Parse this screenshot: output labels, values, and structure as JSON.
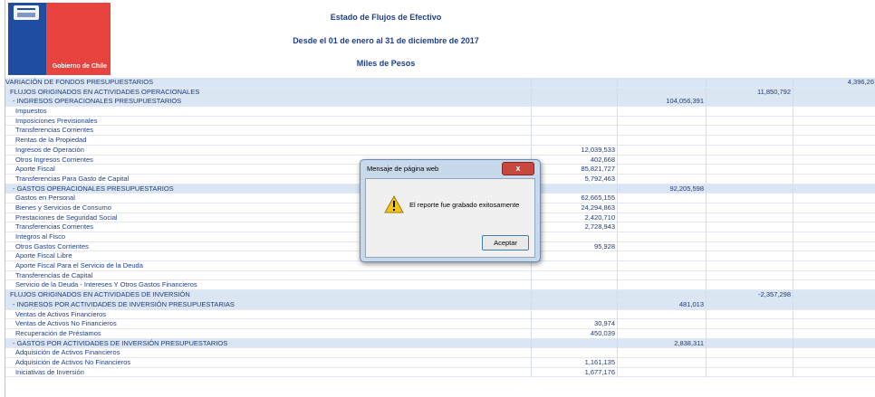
{
  "header": {
    "logo_text": "Gobierno de Chile",
    "title": "Estado de Flujos de Efectivo",
    "subtitle": "Desde el 01 de enero al 31 de diciembre de 2017",
    "units": "Miles de Pesos"
  },
  "rows": [
    {
      "label": "VARIACIÓN DE FONDOS PRESUPUESTARIOS",
      "level": 1,
      "section": true,
      "c1": "",
      "c2": "",
      "c3": "",
      "c4": "4,396,26"
    },
    {
      "label": "FLUJOS ORIGINADOS EN ACTIVIDADES OPERACIONALES",
      "level": 2,
      "section": true,
      "c1": "",
      "c2": "",
      "c3": "11,850,792",
      "c4": ""
    },
    {
      "label": "- INGRESOS OPERACIONALES PRESUPUESTARIOS",
      "level": 3,
      "section": true,
      "c1": "",
      "c2": "104,056,391",
      "c3": "",
      "c4": ""
    },
    {
      "label": "Impuestos",
      "level": 4,
      "section": false,
      "c1": "",
      "c2": "",
      "c3": "",
      "c4": ""
    },
    {
      "label": "Imposiciones Previsionales",
      "level": 4,
      "section": false,
      "c1": "",
      "c2": "",
      "c3": "",
      "c4": ""
    },
    {
      "label": "Transferencias Corrientes",
      "level": 4,
      "section": false,
      "c1": "",
      "c2": "",
      "c3": "",
      "c4": ""
    },
    {
      "label": "Rentas de la Propiedad",
      "level": 4,
      "section": false,
      "c1": "",
      "c2": "",
      "c3": "",
      "c4": ""
    },
    {
      "label": "Ingresos de Operación",
      "level": 4,
      "section": false,
      "c1": "12,039,533",
      "c2": "",
      "c3": "",
      "c4": ""
    },
    {
      "label": "Otros Ingresos Corrientes",
      "level": 4,
      "section": false,
      "c1": "402,668",
      "c2": "",
      "c3": "",
      "c4": ""
    },
    {
      "label": "Aporte Fiscal",
      "level": 4,
      "section": false,
      "c1": "85,821,727",
      "c2": "",
      "c3": "",
      "c4": ""
    },
    {
      "label": "Transferencias Para Gasto de Capital",
      "level": 4,
      "section": false,
      "c1": "5,792,463",
      "c2": "",
      "c3": "",
      "c4": ""
    },
    {
      "label": "- GASTOS OPERACIONALES PRESUPUESTARIOS",
      "level": 3,
      "section": true,
      "c1": "",
      "c2": "92,205,598",
      "c3": "",
      "c4": ""
    },
    {
      "label": "Gastos en Personal",
      "level": 4,
      "section": false,
      "c1": "62,665,155",
      "c2": "",
      "c3": "",
      "c4": ""
    },
    {
      "label": "Bienes y Servicios de Consumo",
      "level": 4,
      "section": false,
      "c1": "24,294,863",
      "c2": "",
      "c3": "",
      "c4": ""
    },
    {
      "label": "Prestaciones de Seguridad Social",
      "level": 4,
      "section": false,
      "c1": "2,420,710",
      "c2": "",
      "c3": "",
      "c4": ""
    },
    {
      "label": "Transferencias Corrientes",
      "level": 4,
      "section": false,
      "c1": "2,728,943",
      "c2": "",
      "c3": "",
      "c4": ""
    },
    {
      "label": "Integros al Fisco",
      "level": 4,
      "section": false,
      "c1": "",
      "c2": "",
      "c3": "",
      "c4": ""
    },
    {
      "label": "Otros Gastos Corrientes",
      "level": 4,
      "section": false,
      "c1": "95,928",
      "c2": "",
      "c3": "",
      "c4": ""
    },
    {
      "label": "Aporte Fiscal Libre",
      "level": 4,
      "section": false,
      "c1": "",
      "c2": "",
      "c3": "",
      "c4": ""
    },
    {
      "label": "Aporte Fiscal Para el Servicio de la Deuda",
      "level": 4,
      "section": false,
      "c1": "",
      "c2": "",
      "c3": "",
      "c4": ""
    },
    {
      "label": "Transferencias de Capital",
      "level": 4,
      "section": false,
      "c1": "",
      "c2": "",
      "c3": "",
      "c4": ""
    },
    {
      "label": "Servicio de la Deuda - Intereses Y Otros Gastos Financieros",
      "level": 4,
      "section": false,
      "c1": "",
      "c2": "",
      "c3": "",
      "c4": ""
    },
    {
      "label": "FLUJOS ORIGINADOS EN ACTIVIDADES DE INVERSIÓN",
      "level": 2,
      "section": true,
      "c1": "",
      "c2": "",
      "c3": "-2,357,298",
      "c4": ""
    },
    {
      "label": "- INGRESOS POR ACTIVIDADES DE INVERSIÓN PRESUPUESTARIAS",
      "level": 3,
      "section": true,
      "c1": "",
      "c2": "481,013",
      "c3": "",
      "c4": ""
    },
    {
      "label": "Ventas de Activos Financieros",
      "level": 4,
      "section": false,
      "c1": "",
      "c2": "",
      "c3": "",
      "c4": ""
    },
    {
      "label": "Ventas de Activos No Financieros",
      "level": 4,
      "section": false,
      "c1": "30,974",
      "c2": "",
      "c3": "",
      "c4": ""
    },
    {
      "label": "Recuperación de Préstamos",
      "level": 4,
      "section": false,
      "c1": "450,039",
      "c2": "",
      "c3": "",
      "c4": ""
    },
    {
      "label": "- GASTOS POR ACTIVIDADES DE INVERSIÓN PRESUPUESTARIOS",
      "level": 3,
      "section": true,
      "c1": "",
      "c2": "2,838,311",
      "c3": "",
      "c4": ""
    },
    {
      "label": "Adquisición de Activos Financieros",
      "level": 4,
      "section": false,
      "c1": "",
      "c2": "",
      "c3": "",
      "c4": ""
    },
    {
      "label": "Adquisición de Activos No Financieros",
      "level": 4,
      "section": false,
      "c1": "1,161,135",
      "c2": "",
      "c3": "",
      "c4": ""
    },
    {
      "label": "Iniciativas de Inversión",
      "level": 4,
      "section": false,
      "c1": "1,677,176",
      "c2": "",
      "c3": "",
      "c4": ""
    }
  ],
  "dialog": {
    "title": "Mensaje de página web",
    "close_label": "x",
    "icon": "warning-icon",
    "message": "El reporte fue grabado exitosamente",
    "accept_label": "Aceptar"
  }
}
